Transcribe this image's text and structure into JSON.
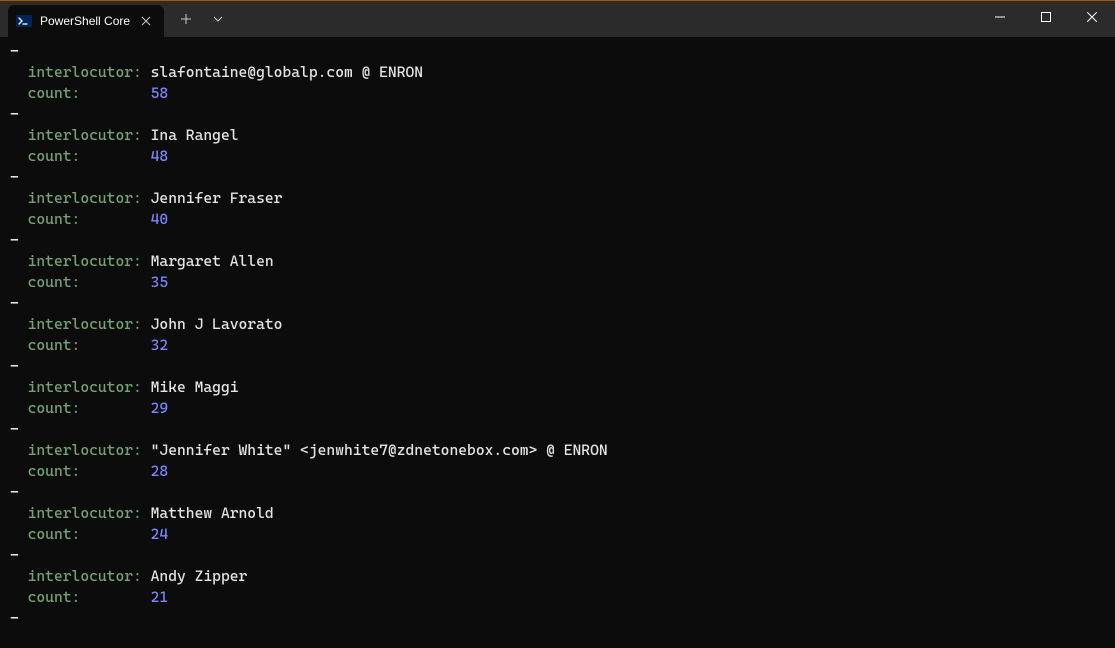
{
  "window": {
    "tab_title": "PowerShell Core"
  },
  "labels": {
    "interlocutor": "interlocutor:",
    "count": "count:"
  },
  "records": [
    {
      "interlocutor": "slafontaine@globalp.com @ ENRON",
      "count": "58"
    },
    {
      "interlocutor": "Ina Rangel",
      "count": "48"
    },
    {
      "interlocutor": "Jennifer Fraser",
      "count": "40"
    },
    {
      "interlocutor": "Margaret Allen",
      "count": "35"
    },
    {
      "interlocutor": "John J Lavorato",
      "count": "32"
    },
    {
      "interlocutor": "Mike Maggi",
      "count": "29"
    },
    {
      "interlocutor": "\"Jennifer White\" <jenwhite7@zdnetonebox.com> @ ENRON",
      "count": "28"
    },
    {
      "interlocutor": "Matthew Arnold",
      "count": "24"
    },
    {
      "interlocutor": "Andy Zipper",
      "count": "21"
    }
  ]
}
